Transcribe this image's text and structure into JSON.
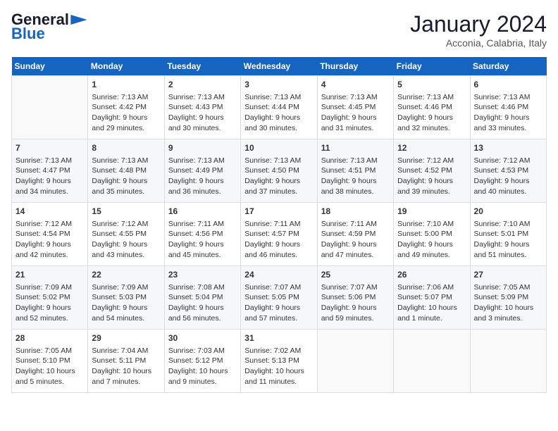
{
  "header": {
    "logo_line1": "General",
    "logo_line2": "Blue",
    "month": "January 2024",
    "location": "Acconia, Calabria, Italy"
  },
  "weekdays": [
    "Sunday",
    "Monday",
    "Tuesday",
    "Wednesday",
    "Thursday",
    "Friday",
    "Saturday"
  ],
  "weeks": [
    [
      {
        "day": "",
        "info": ""
      },
      {
        "day": "1",
        "info": "Sunrise: 7:13 AM\nSunset: 4:42 PM\nDaylight: 9 hours\nand 29 minutes."
      },
      {
        "day": "2",
        "info": "Sunrise: 7:13 AM\nSunset: 4:43 PM\nDaylight: 9 hours\nand 30 minutes."
      },
      {
        "day": "3",
        "info": "Sunrise: 7:13 AM\nSunset: 4:44 PM\nDaylight: 9 hours\nand 30 minutes."
      },
      {
        "day": "4",
        "info": "Sunrise: 7:13 AM\nSunset: 4:45 PM\nDaylight: 9 hours\nand 31 minutes."
      },
      {
        "day": "5",
        "info": "Sunrise: 7:13 AM\nSunset: 4:46 PM\nDaylight: 9 hours\nand 32 minutes."
      },
      {
        "day": "6",
        "info": "Sunrise: 7:13 AM\nSunset: 4:46 PM\nDaylight: 9 hours\nand 33 minutes."
      }
    ],
    [
      {
        "day": "7",
        "info": "Sunrise: 7:13 AM\nSunset: 4:47 PM\nDaylight: 9 hours\nand 34 minutes."
      },
      {
        "day": "8",
        "info": "Sunrise: 7:13 AM\nSunset: 4:48 PM\nDaylight: 9 hours\nand 35 minutes."
      },
      {
        "day": "9",
        "info": "Sunrise: 7:13 AM\nSunset: 4:49 PM\nDaylight: 9 hours\nand 36 minutes."
      },
      {
        "day": "10",
        "info": "Sunrise: 7:13 AM\nSunset: 4:50 PM\nDaylight: 9 hours\nand 37 minutes."
      },
      {
        "day": "11",
        "info": "Sunrise: 7:13 AM\nSunset: 4:51 PM\nDaylight: 9 hours\nand 38 minutes."
      },
      {
        "day": "12",
        "info": "Sunrise: 7:12 AM\nSunset: 4:52 PM\nDaylight: 9 hours\nand 39 minutes."
      },
      {
        "day": "13",
        "info": "Sunrise: 7:12 AM\nSunset: 4:53 PM\nDaylight: 9 hours\nand 40 minutes."
      }
    ],
    [
      {
        "day": "14",
        "info": "Sunrise: 7:12 AM\nSunset: 4:54 PM\nDaylight: 9 hours\nand 42 minutes."
      },
      {
        "day": "15",
        "info": "Sunrise: 7:12 AM\nSunset: 4:55 PM\nDaylight: 9 hours\nand 43 minutes."
      },
      {
        "day": "16",
        "info": "Sunrise: 7:11 AM\nSunset: 4:56 PM\nDaylight: 9 hours\nand 45 minutes."
      },
      {
        "day": "17",
        "info": "Sunrise: 7:11 AM\nSunset: 4:57 PM\nDaylight: 9 hours\nand 46 minutes."
      },
      {
        "day": "18",
        "info": "Sunrise: 7:11 AM\nSunset: 4:59 PM\nDaylight: 9 hours\nand 47 minutes."
      },
      {
        "day": "19",
        "info": "Sunrise: 7:10 AM\nSunset: 5:00 PM\nDaylight: 9 hours\nand 49 minutes."
      },
      {
        "day": "20",
        "info": "Sunrise: 7:10 AM\nSunset: 5:01 PM\nDaylight: 9 hours\nand 51 minutes."
      }
    ],
    [
      {
        "day": "21",
        "info": "Sunrise: 7:09 AM\nSunset: 5:02 PM\nDaylight: 9 hours\nand 52 minutes."
      },
      {
        "day": "22",
        "info": "Sunrise: 7:09 AM\nSunset: 5:03 PM\nDaylight: 9 hours\nand 54 minutes."
      },
      {
        "day": "23",
        "info": "Sunrise: 7:08 AM\nSunset: 5:04 PM\nDaylight: 9 hours\nand 56 minutes."
      },
      {
        "day": "24",
        "info": "Sunrise: 7:07 AM\nSunset: 5:05 PM\nDaylight: 9 hours\nand 57 minutes."
      },
      {
        "day": "25",
        "info": "Sunrise: 7:07 AM\nSunset: 5:06 PM\nDaylight: 9 hours\nand 59 minutes."
      },
      {
        "day": "26",
        "info": "Sunrise: 7:06 AM\nSunset: 5:07 PM\nDaylight: 10 hours\nand 1 minute."
      },
      {
        "day": "27",
        "info": "Sunrise: 7:05 AM\nSunset: 5:09 PM\nDaylight: 10 hours\nand 3 minutes."
      }
    ],
    [
      {
        "day": "28",
        "info": "Sunrise: 7:05 AM\nSunset: 5:10 PM\nDaylight: 10 hours\nand 5 minutes."
      },
      {
        "day": "29",
        "info": "Sunrise: 7:04 AM\nSunset: 5:11 PM\nDaylight: 10 hours\nand 7 minutes."
      },
      {
        "day": "30",
        "info": "Sunrise: 7:03 AM\nSunset: 5:12 PM\nDaylight: 10 hours\nand 9 minutes."
      },
      {
        "day": "31",
        "info": "Sunrise: 7:02 AM\nSunset: 5:13 PM\nDaylight: 10 hours\nand 11 minutes."
      },
      {
        "day": "",
        "info": ""
      },
      {
        "day": "",
        "info": ""
      },
      {
        "day": "",
        "info": ""
      }
    ]
  ]
}
